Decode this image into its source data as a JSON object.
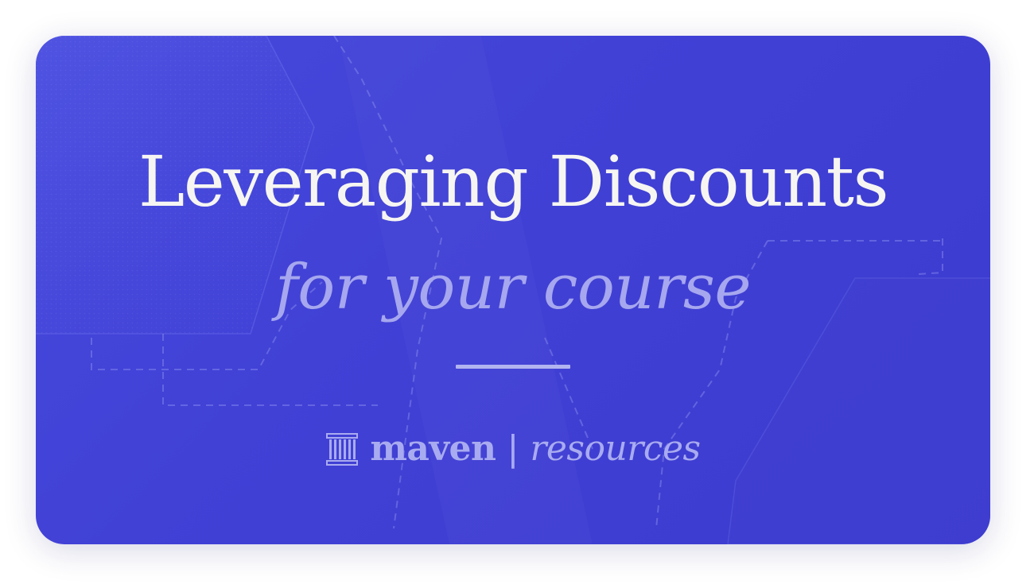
{
  "card": {
    "title": "Leveraging Discounts",
    "subtitle": "for your course"
  },
  "brand": {
    "logo_icon": "maven-columns-icon",
    "name": "maven",
    "separator": "|",
    "section": "resources"
  },
  "colors": {
    "card_background": "#4242d8",
    "title": "#f6f5f2",
    "subtitle": "#a6a7ee",
    "accent": "#a9abf0"
  }
}
